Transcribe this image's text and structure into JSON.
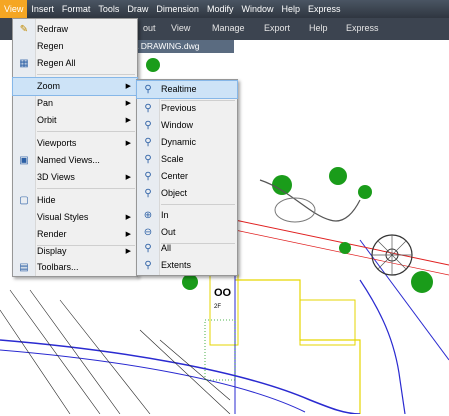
{
  "menubar": {
    "items": [
      "View",
      "Insert",
      "Format",
      "Tools",
      "Draw",
      "Dimension",
      "Modify",
      "Window",
      "Help",
      "Express"
    ]
  },
  "ribbon": {
    "tabs": [
      "out",
      "View",
      "Manage",
      "Export",
      "Help",
      "Express"
    ],
    "doc_tab": "L DRAWING.dwg"
  },
  "view_menu": {
    "items": [
      {
        "label": "Redraw",
        "icon": "redraw-icon",
        "submenu": false
      },
      {
        "label": "Regen",
        "icon": "",
        "submenu": false
      },
      {
        "label": "Regen All",
        "icon": "regen-all-icon",
        "submenu": false
      },
      {
        "label": "Zoom",
        "icon": "",
        "submenu": true
      },
      {
        "label": "Pan",
        "icon": "",
        "submenu": true
      },
      {
        "label": "Orbit",
        "icon": "",
        "submenu": true
      },
      {
        "label": "Viewports",
        "icon": "",
        "submenu": true
      },
      {
        "label": "Named Views...",
        "icon": "named-views-icon",
        "submenu": false
      },
      {
        "label": "3D Views",
        "icon": "",
        "submenu": true
      },
      {
        "label": "Hide",
        "icon": "hide-icon",
        "submenu": false
      },
      {
        "label": "Visual Styles",
        "icon": "",
        "submenu": true
      },
      {
        "label": "Render",
        "icon": "",
        "submenu": true
      },
      {
        "label": "Display",
        "icon": "",
        "submenu": true
      },
      {
        "label": "Toolbars...",
        "icon": "toolbars-icon",
        "submenu": false
      }
    ],
    "highlighted": "Zoom"
  },
  "zoom_menu": {
    "items": [
      {
        "label": "Realtime",
        "icon": "zoom-realtime-icon"
      },
      {
        "label": "Previous",
        "icon": "zoom-previous-icon"
      },
      {
        "label": "Window",
        "icon": "zoom-window-icon"
      },
      {
        "label": "Dynamic",
        "icon": "zoom-dynamic-icon"
      },
      {
        "label": "Scale",
        "icon": "zoom-scale-icon"
      },
      {
        "label": "Center",
        "icon": "zoom-center-icon"
      },
      {
        "label": "Object",
        "icon": "zoom-object-icon"
      },
      {
        "label": "In",
        "icon": "zoom-in-icon"
      },
      {
        "label": "Out",
        "icon": "zoom-out-icon"
      },
      {
        "label": "All",
        "icon": "zoom-all-icon"
      },
      {
        "label": "Extents",
        "icon": "zoom-extents-icon"
      }
    ],
    "highlighted": "Realtime"
  },
  "drawing": {
    "label_oo": "OO",
    "label_2f": "2F"
  },
  "colors": {
    "menubar_bg": "#3c4450",
    "active_menu": "#f5a623",
    "highlight": "#cde3f7"
  }
}
